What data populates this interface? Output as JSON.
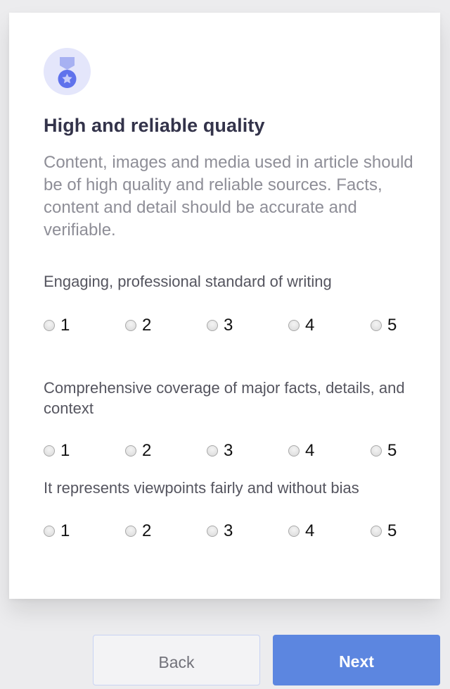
{
  "card": {
    "icon": "medal-icon",
    "title": "High and reliable quality",
    "description": "Content, images and media used in article should be of high quality and reliable sources. Facts, content and detail should be accurate and verifiable."
  },
  "questions": [
    {
      "label": "Engaging, professional standard of writing",
      "options": [
        "1",
        "2",
        "3",
        "4",
        "5"
      ]
    },
    {
      "label": "Comprehensive coverage of major facts, details, and context",
      "options": [
        "1",
        "2",
        "3",
        "4",
        "5"
      ]
    },
    {
      "label": "It represents viewpoints fairly and without bias",
      "options": [
        "1",
        "2",
        "3",
        "4",
        "5"
      ]
    }
  ],
  "buttons": {
    "back": "Back",
    "next": "Next"
  },
  "colors": {
    "accent": "#5c86e0",
    "badge_bg": "#e4e6fb",
    "badge_ribbon": "#a7b1f2",
    "badge_medal": "#5f72ec",
    "title": "#33334a",
    "description": "#8e8e97"
  }
}
